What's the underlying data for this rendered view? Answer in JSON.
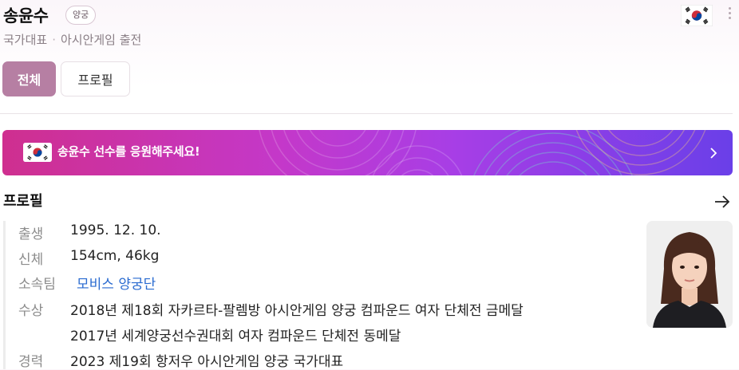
{
  "header": {
    "name": "송윤수",
    "sport_badge": "양궁",
    "subtitle_part1": "국가대표",
    "subtitle_separator": "·",
    "subtitle_part2": "아시안게임 출전",
    "flag_icon": "south-korea-flag-icon",
    "more_icon": "more-vertical-icon"
  },
  "tabs": [
    {
      "label": "전체",
      "active": true
    },
    {
      "label": "프로필",
      "active": false
    }
  ],
  "banner": {
    "text": "송윤수 선수를 응원해주세요!",
    "gradient_start": "#cf2f8f",
    "gradient_end": "#6a3fe8",
    "chevron_icon": "chevron-right-icon"
  },
  "profile": {
    "heading": "프로필",
    "arrow_icon": "arrow-right-icon",
    "rows": [
      {
        "label": "출생",
        "value": "1995. 12. 10."
      },
      {
        "label": "신체",
        "value": "154cm, 46kg"
      },
      {
        "label": "소속팀",
        "value": "모비스 양궁단"
      },
      {
        "label": "수상",
        "values": [
          "2018년 제18회 자카르타-팔렘방 아시안게임 양궁 컴파운드 여자 단체전 금메달",
          "2017년 세계양궁선수권대회 여자 컴파운드 단체전 동메달"
        ]
      },
      {
        "label": "경력",
        "value": "2023 제19회 항저우 아시안게임 양궁 국가대표"
      }
    ]
  },
  "colors": {
    "accent": "#b67fa3",
    "link": "#2a6bd0"
  }
}
